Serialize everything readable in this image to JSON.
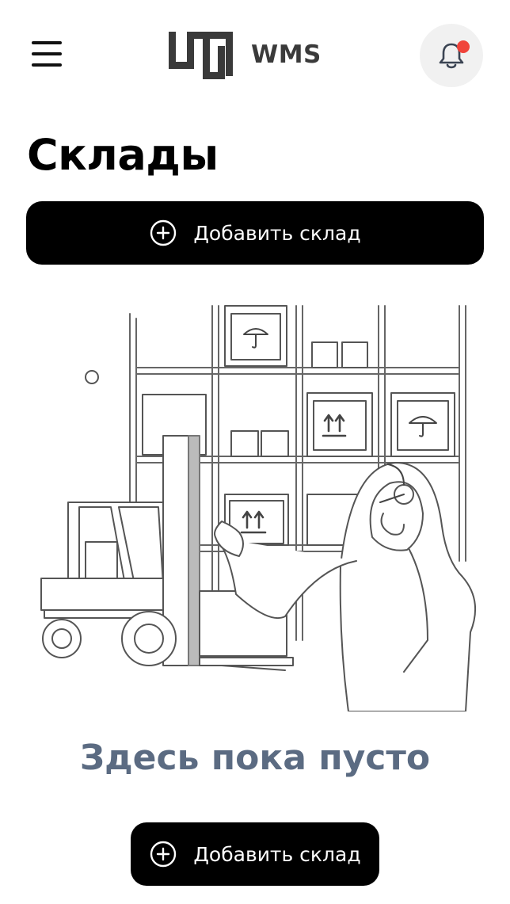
{
  "header": {
    "menu_icon": "hamburger-menu-icon",
    "logo_text": "WMS",
    "notification_icon": "bell-icon",
    "has_unread_notification": true,
    "badge_color": "#f0443b"
  },
  "page": {
    "title": "Склады"
  },
  "actions": {
    "add_warehouse_top_label": "Добавить склад",
    "add_warehouse_bottom_label": "Добавить склад",
    "add_icon": "plus-circle-icon"
  },
  "empty_state": {
    "title": "Здесь пока пусто",
    "title_color": "#5b6b82",
    "illustration": "warehouse-forklift-operator-illustration"
  }
}
